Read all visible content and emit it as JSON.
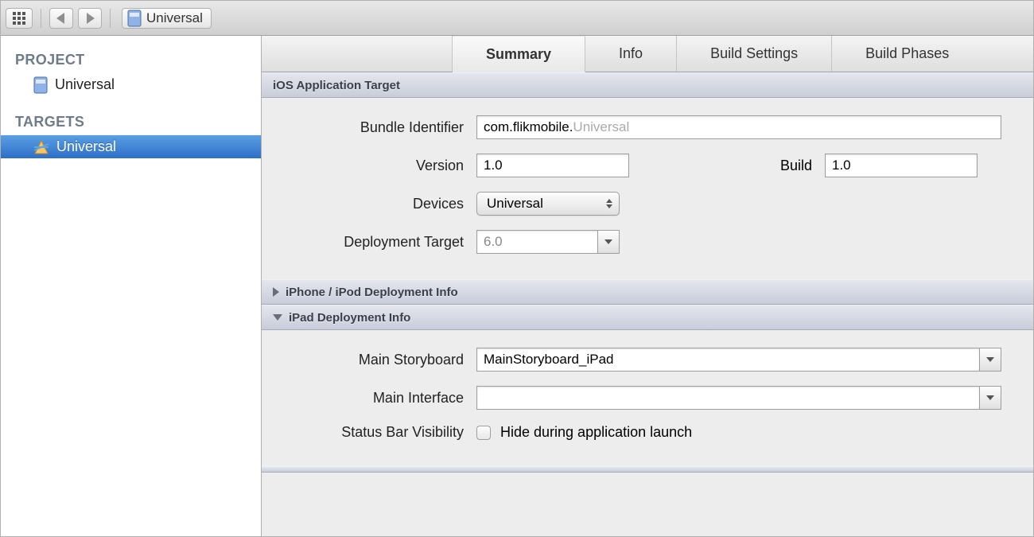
{
  "breadcrumb": {
    "title": "Universal"
  },
  "sidebar": {
    "project_group": "PROJECT",
    "project_name": "Universal",
    "targets_group": "TARGETS",
    "target_name": "Universal"
  },
  "tabs": {
    "summary": "Summary",
    "info": "Info",
    "build_settings": "Build Settings",
    "build_phases": "Build Phases"
  },
  "section_ios_target": "iOS Application Target",
  "form": {
    "bundle_identifier_label": "Bundle Identifier",
    "bundle_identifier_prefix": "com.flikmobile.",
    "bundle_identifier_suffix": "Universal",
    "version_label": "Version",
    "version_value": "1.0",
    "build_label": "Build",
    "build_value": "1.0",
    "devices_label": "Devices",
    "devices_value": "Universal",
    "deployment_target_label": "Deployment Target",
    "deployment_target_value": "6.0"
  },
  "section_iphone": "iPhone / iPod Deployment Info",
  "section_ipad": "iPad Deployment Info",
  "ipad": {
    "main_storyboard_label": "Main Storyboard",
    "main_storyboard_value": "MainStoryboard_iPad",
    "main_interface_label": "Main Interface",
    "main_interface_value": "",
    "status_bar_label": "Status Bar Visibility",
    "status_bar_checkbox_label": "Hide during application launch"
  }
}
